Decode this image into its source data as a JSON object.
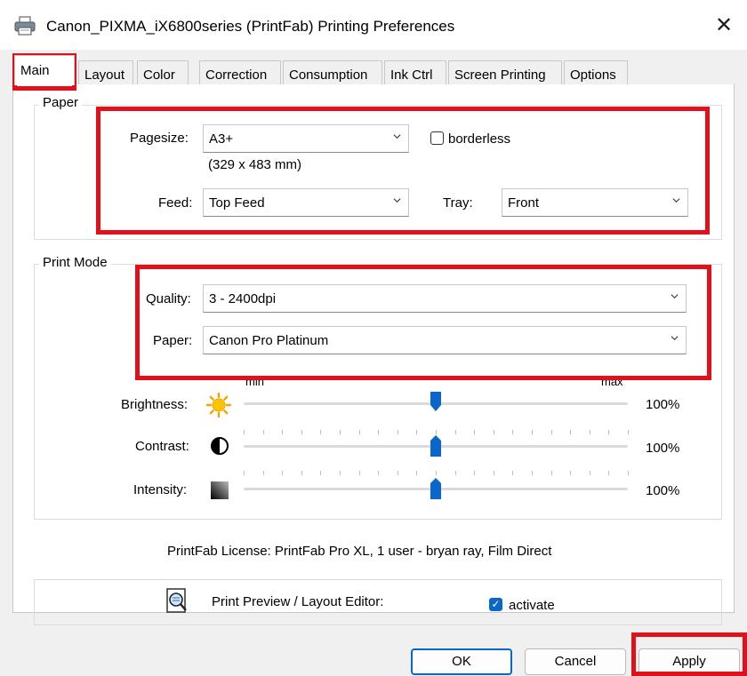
{
  "window": {
    "title": "Canon_PIXMA_iX6800series (PrintFab) Printing Preferences",
    "close_glyph": "✕",
    "icon": "printer-icon"
  },
  "tabs": [
    {
      "label": "Main",
      "active": true
    },
    {
      "label": "Layout"
    },
    {
      "label": "Color"
    },
    {
      "label": "Correction"
    },
    {
      "label": "Consumption"
    },
    {
      "label": "Ink Ctrl"
    },
    {
      "label": "Screen Printing"
    },
    {
      "label": "Options"
    }
  ],
  "paper": {
    "legend": "Paper",
    "pagesize_label": "Pagesize:",
    "pagesize_value": "A3+",
    "pagesize_dims": "(329 x 483 mm)",
    "borderless_label": "borderless",
    "borderless_checked": false,
    "feed_label": "Feed:",
    "feed_value": "Top Feed",
    "tray_label": "Tray:",
    "tray_value": "Front"
  },
  "print_mode": {
    "legend": "Print Mode",
    "quality_label": "Quality:",
    "quality_value": "3 - 2400dpi",
    "paper_label": "Paper:",
    "paper_value": "Canon Pro Platinum",
    "slider_min_label": "min",
    "slider_max_label": "max",
    "brightness_label": "Brightness:",
    "brightness_value": "100%",
    "contrast_label": "Contrast:",
    "contrast_value": "100%",
    "intensity_label": "Intensity:",
    "intensity_value": "100%",
    "slider_level": 0.5
  },
  "license_text": "PrintFab License: PrintFab Pro XL, 1 user - bryan ray, Film Direct",
  "preview": {
    "label": "Print Preview / Layout Editor:",
    "activate_label": "activate",
    "activate_checked": true,
    "icon": "magnifier-icon"
  },
  "buttons": {
    "ok": "OK",
    "cancel": "Cancel",
    "apply": "Apply"
  },
  "highlight_color": "#e0111a",
  "accent_color": "#0a66c8"
}
